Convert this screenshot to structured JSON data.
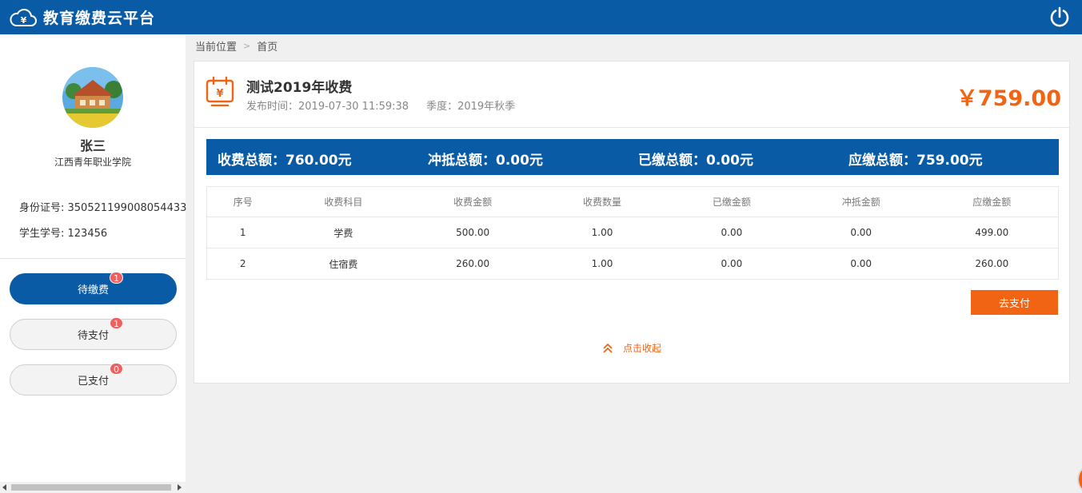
{
  "header": {
    "app_title": "教育缴费云平台",
    "logo_glyph": "¥",
    "icons": {
      "logo": "cloud-yuan-icon",
      "power": "power-icon"
    },
    "colors": {
      "bar": "#0a5ba6"
    }
  },
  "sidebar": {
    "user_name": "张三",
    "school": "江西青年职业学院",
    "id_card": "身份证号: 350521199008054433",
    "student_no": "学生学号: 123456",
    "nav": [
      {
        "label": "待缴费",
        "badge": "1",
        "active": true
      },
      {
        "label": "待支付",
        "badge": "1",
        "active": false
      },
      {
        "label": "已支付",
        "badge": "0",
        "active": false
      }
    ]
  },
  "breadcrumb": {
    "location": "当前位置",
    "current": "首页"
  },
  "fee": {
    "icon": "calendar-yuan-icon",
    "icon_glyph": "¥",
    "title": "测试2019年收费",
    "publish_time": "发布时间：2019-07-30 11:59:38",
    "season": "季度：2019年秋季",
    "amount": "￥759.00",
    "accent_color": "#f06414"
  },
  "summary": {
    "total": "收费总额：760.00元",
    "offset": "冲抵总额：0.00元",
    "paid": "已缴总额：0.00元",
    "due": "应缴总额：759.00元"
  },
  "table": {
    "headers": [
      "序号",
      "收费科目",
      "收费金额",
      "收费数量",
      "已缴金额",
      "冲抵金额",
      "应缴金额"
    ],
    "rows": [
      [
        "1",
        "学费",
        "500.00",
        "1.00",
        "0.00",
        "0.00",
        "499.00"
      ],
      [
        "2",
        "住宿费",
        "260.00",
        "1.00",
        "0.00",
        "0.00",
        "260.00"
      ]
    ]
  },
  "actions": {
    "pay_label": "去支付",
    "collapse_label": "点击收起",
    "collapse_icon": "double-chevron-up-icon"
  }
}
